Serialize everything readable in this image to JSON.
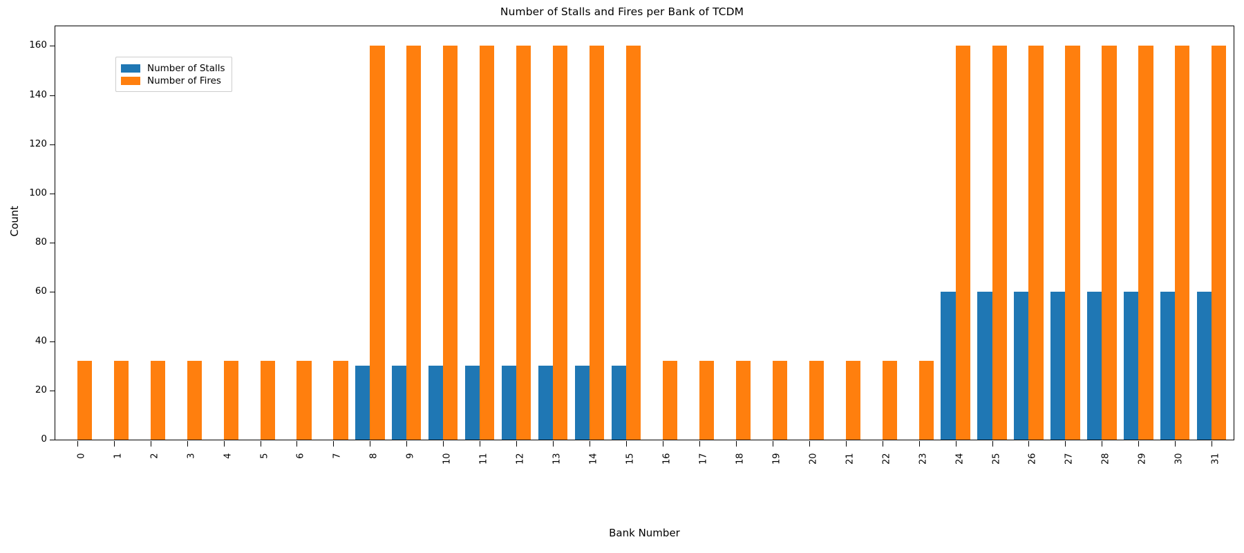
{
  "chart_data": {
    "type": "bar",
    "title": "Number of Stalls and Fires per Bank of TCDM",
    "xlabel": "Bank Number",
    "ylabel": "Count",
    "grid": false,
    "legend_position": "upper left",
    "xlim": [
      -0.6,
      31.6
    ],
    "ylim": [
      0,
      168
    ],
    "ytick_labels": [
      "0",
      "20",
      "40",
      "60",
      "80",
      "100",
      "120",
      "140",
      "160"
    ],
    "yticks": [
      0,
      20,
      40,
      60,
      80,
      100,
      120,
      140,
      160
    ],
    "categories": [
      "0",
      "1",
      "2",
      "3",
      "4",
      "5",
      "6",
      "7",
      "8",
      "9",
      "10",
      "11",
      "12",
      "13",
      "14",
      "15",
      "16",
      "17",
      "18",
      "19",
      "20",
      "21",
      "22",
      "23",
      "24",
      "25",
      "26",
      "27",
      "28",
      "29",
      "30",
      "31"
    ],
    "series": [
      {
        "name": "Number of Stalls",
        "color": "#1f77b4",
        "values": [
          0,
          0,
          0,
          0,
          0,
          0,
          0,
          0,
          30,
          30,
          30,
          30,
          30,
          30,
          30,
          30,
          0,
          0,
          0,
          0,
          0,
          0,
          0,
          0,
          60,
          60,
          60,
          60,
          60,
          60,
          60,
          60
        ]
      },
      {
        "name": "Number of Fires",
        "color": "#ff7f0e",
        "values": [
          32,
          32,
          32,
          32,
          32,
          32,
          32,
          32,
          160,
          160,
          160,
          160,
          160,
          160,
          160,
          160,
          32,
          32,
          32,
          32,
          32,
          32,
          32,
          32,
          160,
          160,
          160,
          160,
          160,
          160,
          160,
          160
        ]
      }
    ]
  }
}
